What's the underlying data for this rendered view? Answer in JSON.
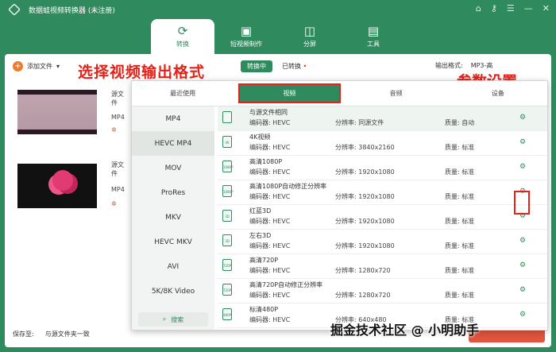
{
  "app": {
    "title": "数据蛙视频转换器 (未注册)",
    "accent": "#2f8a5e",
    "window_controls": [
      "cart-icon",
      "key-icon",
      "menu-icon",
      "minimize-icon",
      "close-icon"
    ]
  },
  "nav": {
    "tabs": [
      {
        "label": "转换",
        "icon": "convert-icon",
        "active": true
      },
      {
        "label": "短视频制作",
        "icon": "tv-icon",
        "active": false
      },
      {
        "label": "分屏",
        "icon": "split-icon",
        "active": false
      },
      {
        "label": "工具",
        "icon": "toolbox-icon",
        "active": false
      }
    ]
  },
  "toolbar": {
    "add_file": "添加文件",
    "mode_converting": "转换中",
    "mode_converted": "已转换",
    "output_format_label": "输出格式:",
    "output_format_value": "MP3-高"
  },
  "annotations": {
    "choose_format": "选择视频输出格式",
    "param_settings": "参数设置"
  },
  "files": [
    {
      "source_label": "源文件",
      "format": "MP4"
    },
    {
      "source_label": "源文件",
      "format": "MP4"
    }
  ],
  "bottom": {
    "save_to_label": "保存至:",
    "save_to_value": "与源文件夹一致"
  },
  "panel": {
    "tabs": [
      "最近使用",
      "视频",
      "音频",
      "设备"
    ],
    "active_tab": "视频",
    "formats": [
      "MP4",
      "HEVC MP4",
      "MOV",
      "ProRes",
      "MKV",
      "HEVC MKV",
      "AVI",
      "5K/8K Video"
    ],
    "active_format": "HEVC MP4",
    "search_label": "搜索",
    "presets": [
      {
        "name": "与源文件相同",
        "encoder": "编码器: HEVC",
        "resolution": "分辨率: 同源文件",
        "quality": "质量: 自动",
        "icon": ""
      },
      {
        "name": "4K视频",
        "encoder": "编码器: HEVC",
        "resolution": "分辨率: 3840x2160",
        "quality": "质量: 标准",
        "icon": "4K"
      },
      {
        "name": "高清1080P",
        "encoder": "编码器: HEVC",
        "resolution": "分辨率: 1920x1080",
        "quality": "质量: 标准",
        "icon": "1080P"
      },
      {
        "name": "高清1080P自动修正分辨率",
        "encoder": "编码器: HEVC",
        "resolution": "分辨率: 1920x1080",
        "quality": "质量: 标准",
        "icon": "1080P"
      },
      {
        "name": "红蓝3D",
        "encoder": "编码器: HEVC",
        "resolution": "分辨率: 1920x1080",
        "quality": "质量: 标准",
        "icon": "3D"
      },
      {
        "name": "左右3D",
        "encoder": "编码器: HEVC",
        "resolution": "分辨率: 1920x1080",
        "quality": "质量: 标准",
        "icon": "3D"
      },
      {
        "name": "高清720P",
        "encoder": "编码器: HEVC",
        "resolution": "分辨率: 1280x720",
        "quality": "质量: 标准",
        "icon": "720P"
      },
      {
        "name": "高清720P自动修正分辨率",
        "encoder": "编码器: HEVC",
        "resolution": "分辨率: 1280x720",
        "quality": "质量: 标准",
        "icon": "720P"
      },
      {
        "name": "标清480P",
        "encoder": "编码器: HEVC",
        "resolution": "分辨率: 640x480",
        "quality": "质量: 标准",
        "icon": "480P"
      }
    ]
  },
  "watermark": "掘金技术社区 @ 小明助手"
}
